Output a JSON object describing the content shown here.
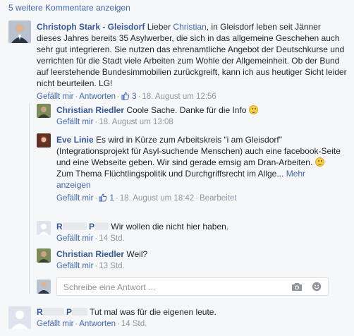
{
  "more_comments": "5 weitere Kommentare anzeigen",
  "colors": {
    "link": "#4267b2",
    "name": "#365899",
    "meta": "#90949c",
    "background": "#f6f7f9"
  },
  "comments": [
    {
      "author": "Christoph Stark - Gleisdorf",
      "text_before_mention": "Lieber ",
      "mention": "Christian",
      "text_after_mention": ", in Gleisdorf leben seit Jänner dieses Jahres bereits 35 Asylwerber, die sich in das allgemeine Geschehen auch sehr gut integrieren. Sie nutzen das ehrenamtliche Angebot der Deutschkurse und verrichten für die Stadt viele Arbeiten zum Wohle der Allgemeinheit. Ob der Bund auf leerstehende Bundesimmobilien zurückgreift, kann ich aus heutiger Sicht leider nicht beurteilen. LG!",
      "like": "Gefällt mir",
      "reply": "Antworten",
      "likes": "3",
      "time": "18. August um 12:56"
    },
    {
      "author": "Christian Riedler",
      "text": "Coole Sache. Danke für die Info",
      "like": "Gefällt mir",
      "time": "18. August um 13:08"
    },
    {
      "author": "Eve Linie",
      "text": "Es wird in Kürze zum Arbeitskreis \"i am Gleisdorf\" (Integrationsprojekt für Asyl-suchende Menschen) auch eine facebook-Seite und eine Webseite geben. Wir sind gerade emsig am Dran-Arbeiten.",
      "text2": "Zum Thema Flüchtlingspolitik und Durchgriffsrecht im Allge...",
      "more": "Mehr anzeigen",
      "like": "Gefällt mir",
      "likes": "1",
      "time": "18. August um 18:42",
      "edited": "Bearbeitet"
    },
    {
      "author_visible_1": "R",
      "author_visible_2": "P",
      "text": "Wir wollen die nicht hier haben.",
      "like": "Gefällt mir",
      "time": "14 Std."
    },
    {
      "author": "Christian Riedler",
      "text": "Weil?",
      "like": "Gefällt mir",
      "time": "13 Std."
    },
    {
      "author_visible_1": "R",
      "author_visible_2": "P",
      "text": "Tut mal was für die eigenen leute.",
      "like": "Gefällt mir",
      "reply": "Antworten",
      "time": "14 Std."
    }
  ],
  "reply_box": {
    "placeholder": "Schreibe eine Antwort ..."
  },
  "icons": {
    "like": "thumbs-up-icon",
    "camera": "camera-icon",
    "emoji": "emoji-icon"
  }
}
